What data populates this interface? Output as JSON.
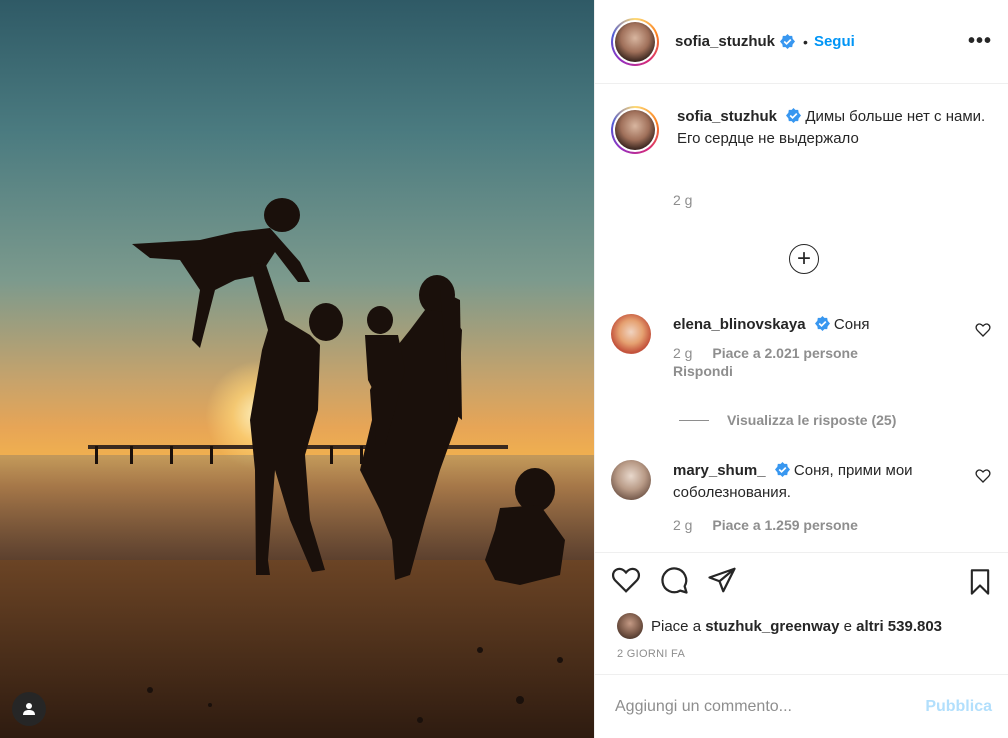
{
  "header": {
    "username": "sofia_stuzhuk",
    "dot": "•",
    "follow_label": "Segui",
    "more_label": "•••"
  },
  "caption": {
    "username": "sofia_stuzhuk",
    "text_line1": "Димы больше нет с нами.",
    "text_line2": "Его сердце не выдержало",
    "time": "2 g"
  },
  "load_more_label": "+",
  "comments": [
    {
      "username": "elena_blinovskaya",
      "text": "Соня",
      "time": "2 g",
      "likes": "Piace a 2.021 persone",
      "reply": "Rispondi",
      "view_replies": "Visualizza le risposte (25)"
    },
    {
      "username": "mary_shum_",
      "text": "Соня, прими мои соболезнования.",
      "time": "2 g",
      "likes": "Piace a 1.259 persone"
    }
  ],
  "actions": {
    "likes_prefix": "Piace a",
    "likes_user": "stuzhuk_greenway",
    "likes_and": "e",
    "likes_others": "altri 539.803",
    "date": "2 GIORNI FA"
  },
  "comment_box": {
    "placeholder": "Aggiungi un commento...",
    "publish_label": "Pubblica"
  },
  "colors": {
    "link": "#0095f6",
    "publish_disabled": "#b2dffc",
    "muted": "#8e8e8e",
    "text": "#262626",
    "verified": "#3897f0"
  },
  "icons": [
    "verified-icon",
    "more-icon",
    "plus-icon",
    "heart-icon",
    "comment-icon",
    "share-icon",
    "bookmark-icon",
    "user-tag-icon"
  ]
}
